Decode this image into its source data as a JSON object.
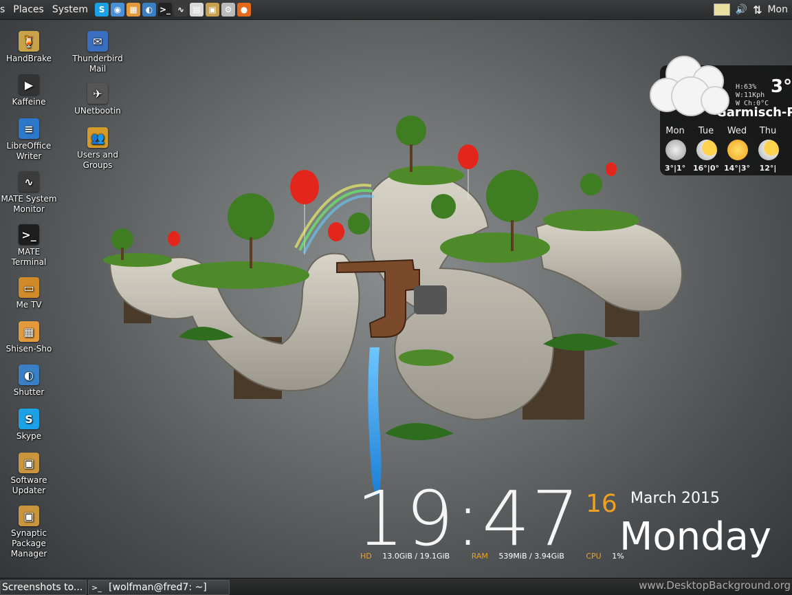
{
  "panel": {
    "menu_apps_partial": "s",
    "menu_places": "Places",
    "menu_system": "System",
    "clock_partial": "Mon",
    "launchers": [
      {
        "icon": "skype-icon",
        "color": "#1da1e6",
        "glyph": "S"
      },
      {
        "icon": "chromium-icon",
        "color": "#4a90d9",
        "glyph": "◉"
      },
      {
        "icon": "shisen-sho-icon",
        "color": "#e39a3c",
        "glyph": "▦"
      },
      {
        "icon": "shutter-icon",
        "color": "#3a7fc4",
        "glyph": "◐"
      },
      {
        "icon": "terminal-icon",
        "color": "#222222",
        "glyph": ">_"
      },
      {
        "icon": "system-monitor-icon",
        "color": "#3b3b3b",
        "glyph": "∿"
      },
      {
        "icon": "file-manager-icon",
        "color": "#d9d9d9",
        "glyph": "▤"
      },
      {
        "icon": "package-manager-icon",
        "color": "#c8a050",
        "glyph": "▣"
      },
      {
        "icon": "control-center-icon",
        "color": "#bbbbbb",
        "glyph": "⚙"
      },
      {
        "icon": "firefox-icon",
        "color": "#e36a1c",
        "glyph": "●"
      }
    ]
  },
  "desktop_icons": [
    {
      "label": "HandBrake",
      "icon": "handbrake-icon",
      "color": "#c9a34a",
      "glyph": "🍹"
    },
    {
      "label": "Kaffeine",
      "icon": "kaffeine-icon",
      "color": "#333333",
      "glyph": "▶"
    },
    {
      "label": "LibreOffice Writer",
      "icon": "libreoffice-writer-icon",
      "color": "#2e78c9",
      "glyph": "≡"
    },
    {
      "label": "MATE System Monitor",
      "icon": "system-monitor-icon",
      "color": "#3c3c3c",
      "glyph": "∿"
    },
    {
      "label": "MATE Terminal",
      "icon": "terminal-icon",
      "color": "#1e1e1e",
      "glyph": ">_"
    },
    {
      "label": "Me TV",
      "icon": "tv-icon",
      "color": "#d08a2a",
      "glyph": "▭"
    },
    {
      "label": "Shisen-Sho",
      "icon": "shisen-sho-icon",
      "color": "#e39a3c",
      "glyph": "▦"
    },
    {
      "label": "Shutter",
      "icon": "shutter-icon",
      "color": "#3a7fc4",
      "glyph": "◐"
    },
    {
      "label": "Skype",
      "icon": "skype-icon",
      "color": "#1da1e6",
      "glyph": "S"
    },
    {
      "label": "Software Updater",
      "icon": "software-updater-icon",
      "color": "#c9953d",
      "glyph": "▣"
    },
    {
      "label": "Synaptic Package Manager",
      "icon": "synaptic-icon",
      "color": "#c9953d",
      "glyph": "▣"
    },
    {
      "label": "Thunderbird Mail",
      "icon": "thunderbird-icon",
      "color": "#3a6fbf",
      "glyph": "✉"
    },
    {
      "label": "UNetbootin",
      "icon": "unetbootin-icon",
      "color": "#555555",
      "glyph": "✈"
    },
    {
      "label": "Users and Groups",
      "icon": "users-groups-icon",
      "color": "#d49a2a",
      "glyph": "👥"
    }
  ],
  "weather": {
    "humidity": "H:63%",
    "wind": "W:11Kph",
    "wind_chill": "W Ch:0°C",
    "current_temp": "3°",
    "location": "Garmisch-P",
    "days": [
      {
        "day": "Mon",
        "temps": "3°|1°",
        "icon": "cloudy-icon"
      },
      {
        "day": "Tue",
        "temps": "16°|0°",
        "icon": "partly-sunny-icon"
      },
      {
        "day": "Wed",
        "temps": "14°|3°",
        "icon": "sunny-icon"
      },
      {
        "day": "Thu",
        "temps": "12°|",
        "icon": "partly-sunny-icon"
      }
    ]
  },
  "clock": {
    "time": "19:47",
    "day_number": "16",
    "month_year": "March 2015",
    "weekday": "Monday",
    "hd_label": "HD",
    "hd_value": "13.0GiB / 19.1GiB",
    "ram_label": "RAM",
    "ram_value": "539MiB  / 3.94GiB",
    "cpu_label": "CPU",
    "cpu_value": "1%"
  },
  "taskbar": {
    "task1": "Screenshots to...",
    "task2": "[wolfman@fred7: ~]"
  },
  "watermark": "www.DesktopBackground.org"
}
